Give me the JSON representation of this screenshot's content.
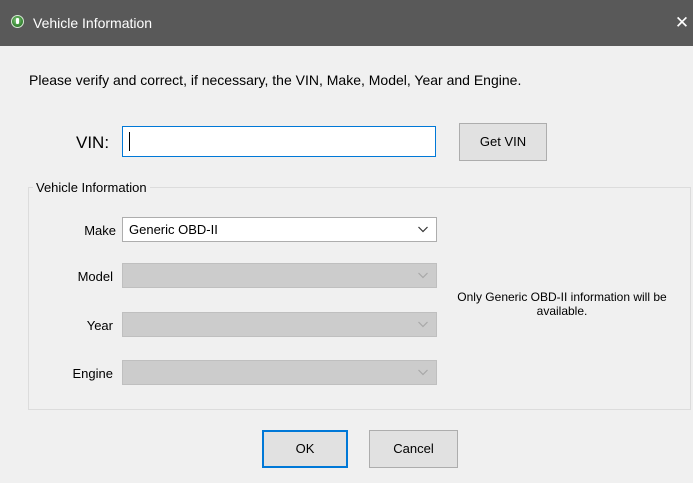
{
  "window": {
    "title": "Vehicle Information",
    "close_glyph": "✕",
    "icon": "app-logo-icon"
  },
  "instruction": "Please verify and correct, if necessary, the VIN, Make, Model, Year and Engine.",
  "vin": {
    "label": "VIN:",
    "value": "",
    "get_vin_label": "Get VIN"
  },
  "vehicle_group": {
    "title": "Vehicle Information",
    "make": {
      "label": "Make",
      "selected": "Generic OBD-II",
      "enabled": true
    },
    "model": {
      "label": "Model",
      "selected": "",
      "enabled": false
    },
    "year": {
      "label": "Year",
      "selected": "",
      "enabled": false
    },
    "engine": {
      "label": "Engine",
      "selected": "",
      "enabled": false
    },
    "note": "Only Generic OBD-II information will be available."
  },
  "buttons": {
    "ok_label": "OK",
    "cancel_label": "Cancel"
  },
  "colors": {
    "titlebar": "#595959",
    "focus_accent": "#0078d7",
    "disabled_field": "#cccccc"
  }
}
